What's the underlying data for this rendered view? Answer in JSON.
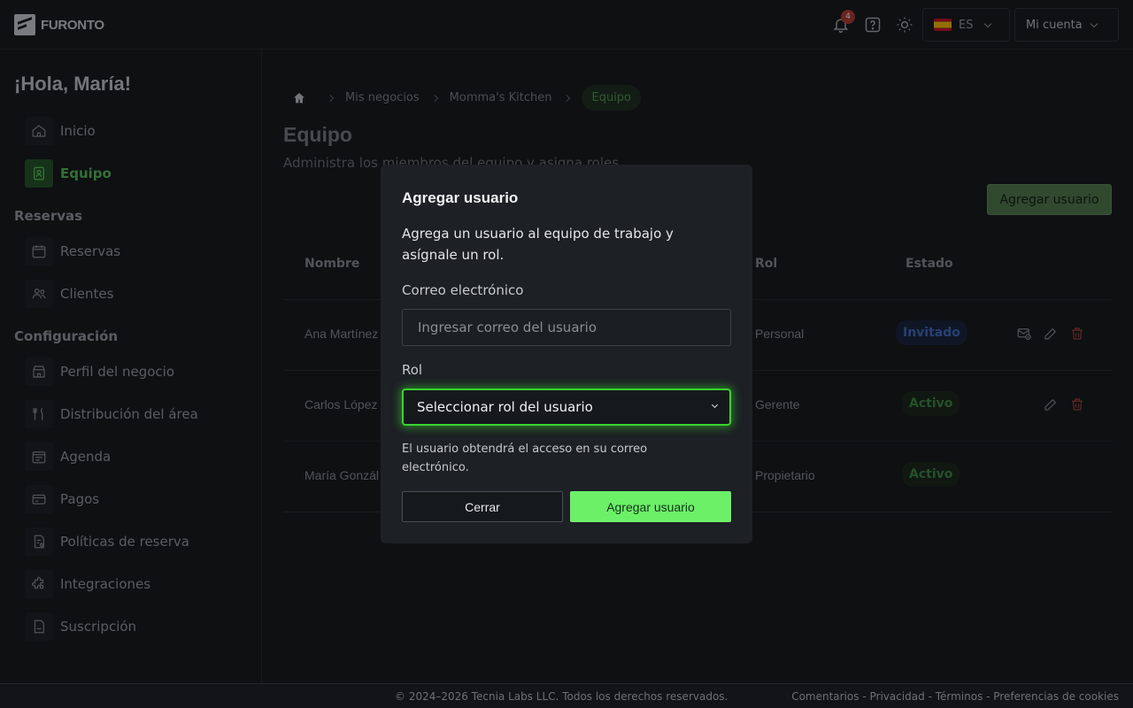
{
  "app": {
    "logo_text": "FURONTO"
  },
  "topbar": {
    "notification_count": "4",
    "language": "ES",
    "account": "Mi cuenta"
  },
  "sidebar": {
    "greeting": "¡Hola, María!",
    "items_top": [
      {
        "label": "Inicio",
        "icon": "home-icon"
      },
      {
        "label": "Equipo",
        "icon": "badge-icon",
        "active": true
      }
    ],
    "section_reservas": "Reservas",
    "items_reservas": [
      {
        "label": "Reservas",
        "icon": "calendar-icon"
      },
      {
        "label": "Clientes",
        "icon": "users-icon"
      }
    ],
    "section_config": "Configuración",
    "items_config": [
      {
        "label": "Perfil del negocio",
        "icon": "store-icon"
      },
      {
        "label": "Distribución del área",
        "icon": "utensils-icon"
      },
      {
        "label": "Agenda",
        "icon": "calendar-list-icon"
      },
      {
        "label": "Pagos",
        "icon": "card-icon"
      },
      {
        "label": "Políticas de reserva",
        "icon": "policy-icon"
      },
      {
        "label": "Integraciones",
        "icon": "puzzle-icon"
      },
      {
        "label": "Suscripción",
        "icon": "subscription-icon"
      }
    ]
  },
  "breadcrumb": [
    "Mis negocios",
    "Momma's Kitchen",
    "Equipo"
  ],
  "page": {
    "title": "Equipo",
    "subtitle": "Administra los miembros del equipo y asigna roles",
    "add_button": "Agregar usuario"
  },
  "table": {
    "headers": {
      "name": "Nombre",
      "role": "Rol",
      "status": "Estado"
    },
    "rows": [
      {
        "name": "Ana Martínez",
        "role": "Personal",
        "status": "Invitado"
      },
      {
        "name": "Carlos López",
        "role": "Gerente",
        "status": "Activo"
      },
      {
        "name": "María Gonzál",
        "role": "Propietario",
        "status": "Activo"
      }
    ]
  },
  "modal": {
    "title": "Agregar usuario",
    "description": "Agrega un usuario al equipo de trabajo y asígnale un rol.",
    "email_label": "Correo electrónico",
    "email_placeholder": "Ingresar correo del usuario",
    "role_label": "Rol",
    "role_placeholder": "Seleccionar rol del usuario",
    "hint": "El usuario obtendrá el acceso en su correo electrónico.",
    "close": "Cerrar",
    "submit": "Agregar usuario"
  },
  "footer": {
    "copyright": "© 2024–2026 Tecnia Labs LLC. Todos los derechos reservados.",
    "links": "Comentarios - Privacidad - Términos - Preferencias de cookies"
  },
  "colors": {
    "accent": "#6cf068",
    "active_nav": "#54c45a",
    "invited": "#3f6ec8",
    "danger": "#b83a2e"
  }
}
